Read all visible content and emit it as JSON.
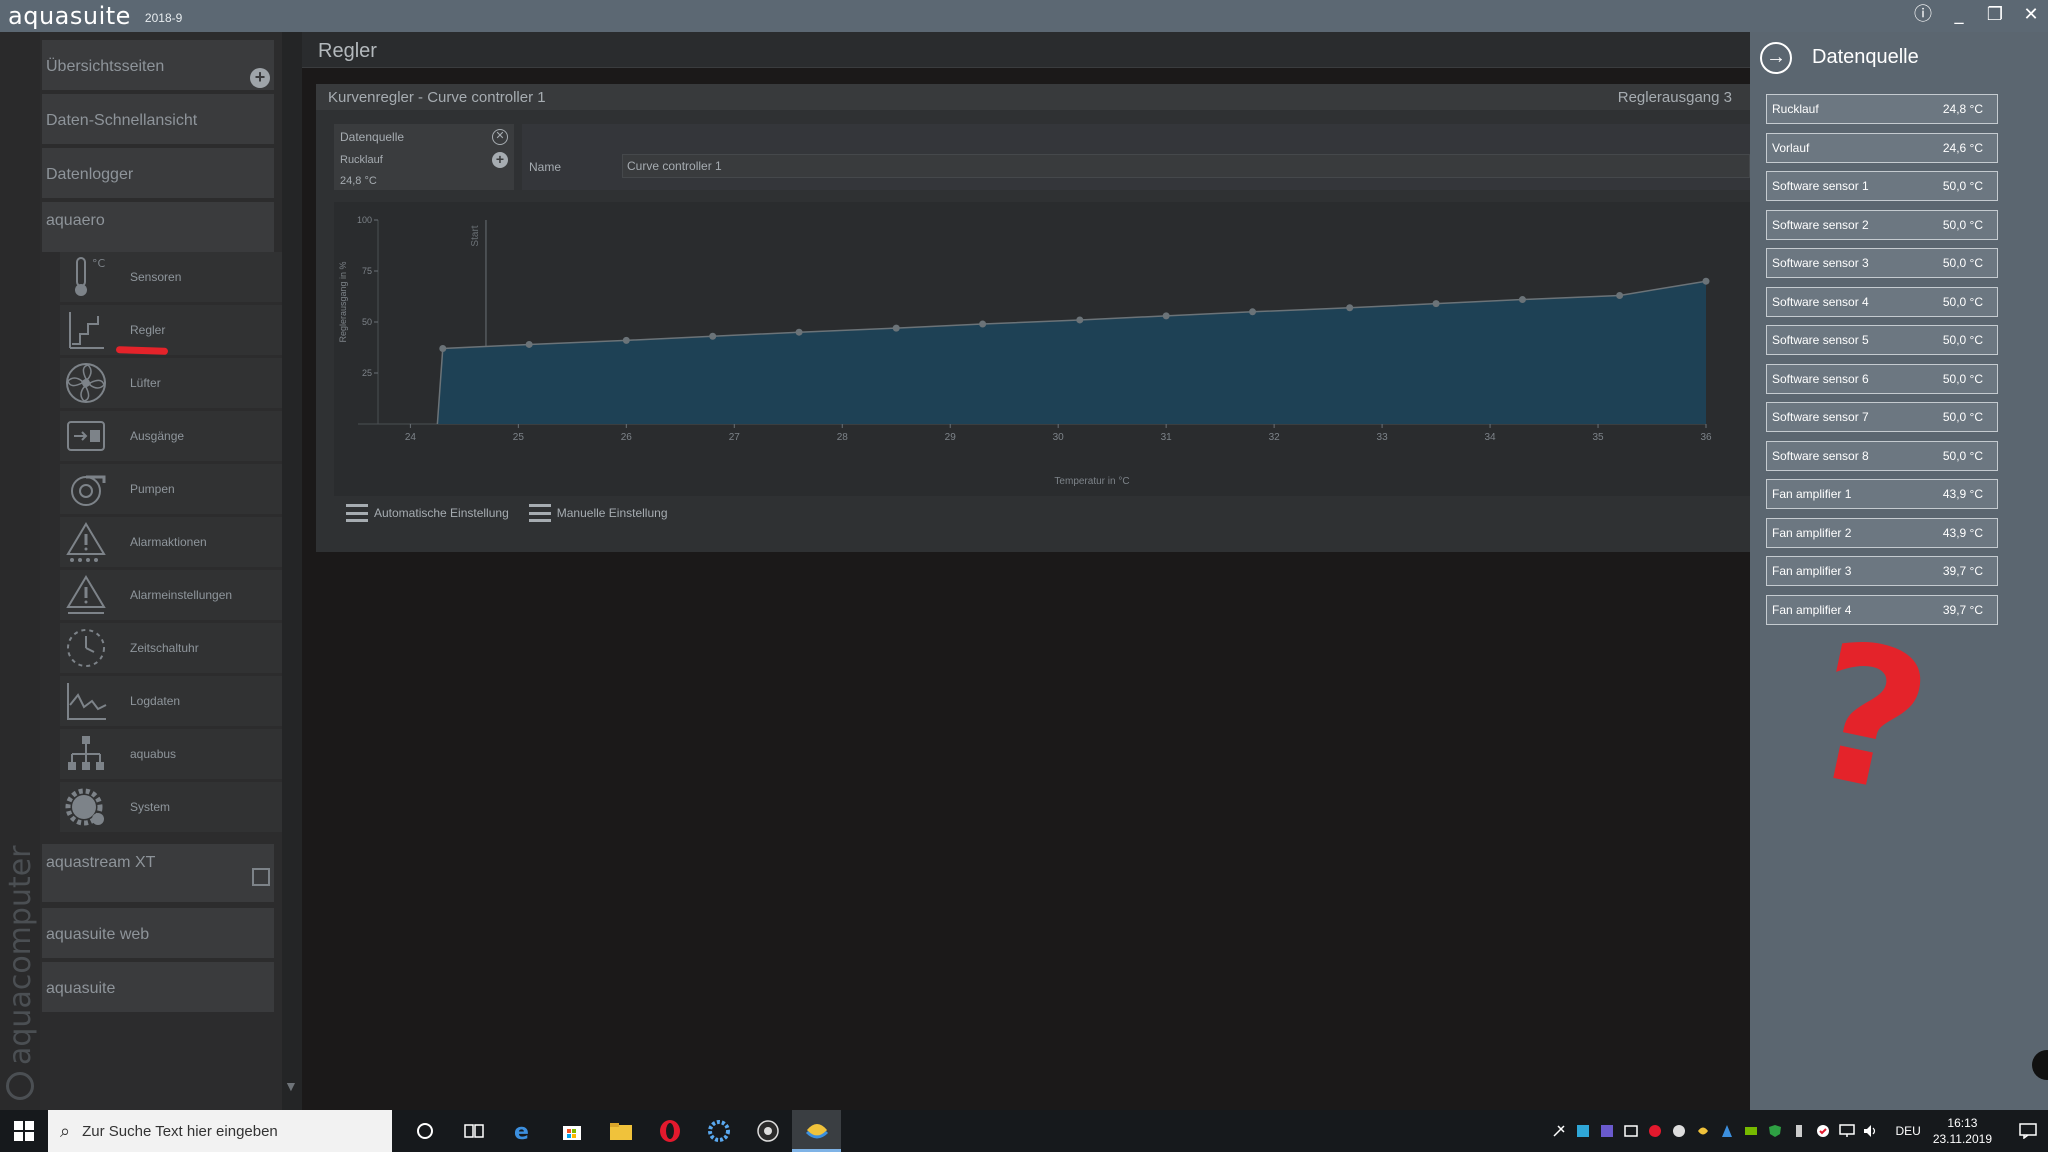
{
  "titlebar": {
    "app_name": "aquasuite",
    "version": "2018-9"
  },
  "brand": {
    "vertical_text": "aquacomputer"
  },
  "sidebar": {
    "sections": [
      {
        "label": "Übersichtsseiten"
      },
      {
        "label": "Daten-Schnellansicht"
      },
      {
        "label": "Datenlogger"
      },
      {
        "label": "aquaero"
      }
    ],
    "items": [
      {
        "label": "Sensoren",
        "icon": "thermometer-icon"
      },
      {
        "label": "Regler",
        "icon": "controller-icon"
      },
      {
        "label": "Lüfter",
        "icon": "fan-icon"
      },
      {
        "label": "Ausgänge",
        "icon": "outputs-icon"
      },
      {
        "label": "Pumpen",
        "icon": "pump-icon"
      },
      {
        "label": "Alarmaktionen",
        "icon": "alarm-actions-icon"
      },
      {
        "label": "Alarmeinstellungen",
        "icon": "alarm-settings-icon"
      },
      {
        "label": "Zeitschaltuhr",
        "icon": "timer-icon"
      },
      {
        "label": "Logdaten",
        "icon": "logdata-icon"
      },
      {
        "label": "aquabus",
        "icon": "aquabus-icon"
      },
      {
        "label": "System",
        "icon": "system-gear-icon"
      }
    ],
    "bottom_sections": [
      {
        "label": "aquastream XT"
      },
      {
        "label": "aquasuite web"
      },
      {
        "label": "aquasuite"
      }
    ]
  },
  "main": {
    "page_title": "Regler",
    "card_title": "Kurvenregler  -  Curve controller 1",
    "output_label": "Reglerausgang  3",
    "datasource": {
      "title": "Datenquelle",
      "sensor": "Rucklauf",
      "value": "24,8 °C"
    },
    "name_label": "Name",
    "name_value": "Curve controller 1",
    "buttons": {
      "auto": "Automatische Einstellung",
      "manual": "Manuelle Einstellung"
    }
  },
  "chart_data": {
    "type": "area",
    "xlabel": "Temperatur in °C",
    "ylabel": "Reglerausgang in %",
    "xlim": [
      23.7,
      36
    ],
    "ylim": [
      0,
      100
    ],
    "x_ticks": [
      24,
      25,
      26,
      27,
      28,
      29,
      30,
      31,
      32,
      33,
      34,
      35,
      36
    ],
    "y_ticks": [
      25,
      50,
      75,
      100
    ],
    "marker_label": "Start",
    "marker_x": 24.7,
    "x": [
      24.25,
      24.3,
      25.1,
      26.0,
      26.8,
      27.6,
      28.5,
      29.3,
      30.2,
      31.0,
      31.8,
      32.7,
      33.5,
      34.3,
      35.2,
      36.0
    ],
    "y": [
      0,
      37,
      39,
      41,
      43,
      45,
      47,
      49,
      51,
      53,
      55,
      57,
      59,
      61,
      63,
      70
    ]
  },
  "panel": {
    "title": "Datenquelle",
    "items": [
      {
        "name": "Rucklauf",
        "value": "24,8 °C"
      },
      {
        "name": "Vorlauf",
        "value": "24,6 °C"
      },
      {
        "name": "Software sensor 1",
        "value": "50,0 °C"
      },
      {
        "name": "Software sensor 2",
        "value": "50,0 °C"
      },
      {
        "name": "Software sensor 3",
        "value": "50,0 °C"
      },
      {
        "name": "Software sensor 4",
        "value": "50,0 °C"
      },
      {
        "name": "Software sensor 5",
        "value": "50,0 °C"
      },
      {
        "name": "Software sensor 6",
        "value": "50,0 °C"
      },
      {
        "name": "Software sensor 7",
        "value": "50,0 °C"
      },
      {
        "name": "Software sensor 8",
        "value": "50,0 °C"
      },
      {
        "name": "Fan amplifier 1",
        "value": "43,9 °C"
      },
      {
        "name": "Fan amplifier 2",
        "value": "43,9 °C"
      },
      {
        "name": "Fan amplifier 3",
        "value": "39,7 °C"
      },
      {
        "name": "Fan amplifier 4",
        "value": "39,7 °C"
      }
    ],
    "annotation": "?"
  },
  "taskbar": {
    "search_placeholder": "Zur Suche Text hier eingeben",
    "language": "DEU",
    "time": "16:13",
    "date": "23.11.2019"
  },
  "colors": {
    "accent_red": "#e4232a",
    "panel_bg": "#5b6670",
    "chart_fill": "#1e4155"
  }
}
